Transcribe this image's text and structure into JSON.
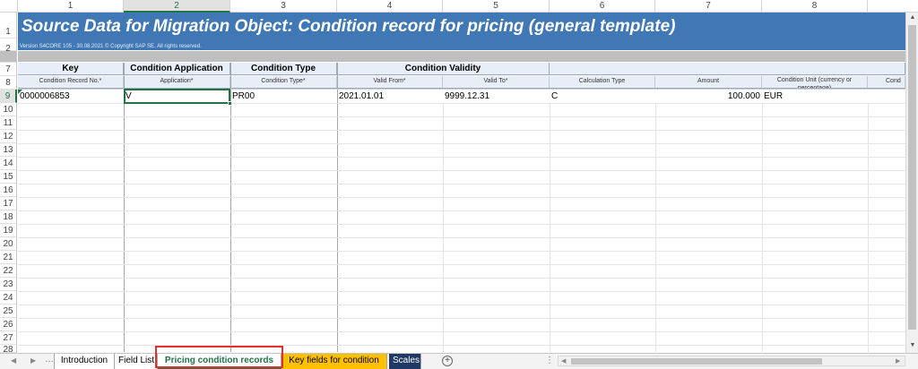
{
  "columns": [
    "1",
    "2",
    "3",
    "4",
    "5",
    "6",
    "7",
    "8"
  ],
  "rows": [
    "1",
    "2",
    "7",
    "8",
    "9",
    "10",
    "11",
    "12",
    "13",
    "14",
    "15",
    "16",
    "17",
    "18",
    "19",
    "20",
    "21",
    "22",
    "23",
    "24",
    "25",
    "26",
    "27",
    "28"
  ],
  "banner": {
    "title": "Source Data for Migration Object:  Condition record for pricing (general template)",
    "version": "Version S4CORE 105  - 30.08.2021 © Copyright SAP SE. All rights reserved."
  },
  "group_headers": [
    "Key",
    "Condition Application",
    "Condition Type",
    "Condition Validity"
  ],
  "field_headers": [
    "Condition Record No.*",
    "Application*",
    "Condition Type*",
    "Valid From*",
    "Valid To*",
    "Calculation Type",
    "Amount",
    "Condition Unit (currency or percentage)",
    "Cond"
  ],
  "data_row": [
    "0000006853",
    "V",
    "PR00",
    "2021.01.01",
    "9999.12.31",
    "C",
    "100.000",
    "EUR"
  ],
  "sheet_tabs": [
    "Introduction",
    "Field List",
    "Pricing condition records",
    "Key fields for condition",
    "Scales"
  ],
  "active_tab": "Pricing condition records",
  "colors": {
    "banner": "#3f78b5",
    "selection": "#217346",
    "highlight": "#e03030",
    "tab_yellow": "#ffc000",
    "tab_navy": "#1f3864"
  },
  "icons": {
    "add_sheet": "plus-circle-icon",
    "scroll_up": "up-arrow-icon",
    "scroll_down": "down-arrow-icon"
  }
}
